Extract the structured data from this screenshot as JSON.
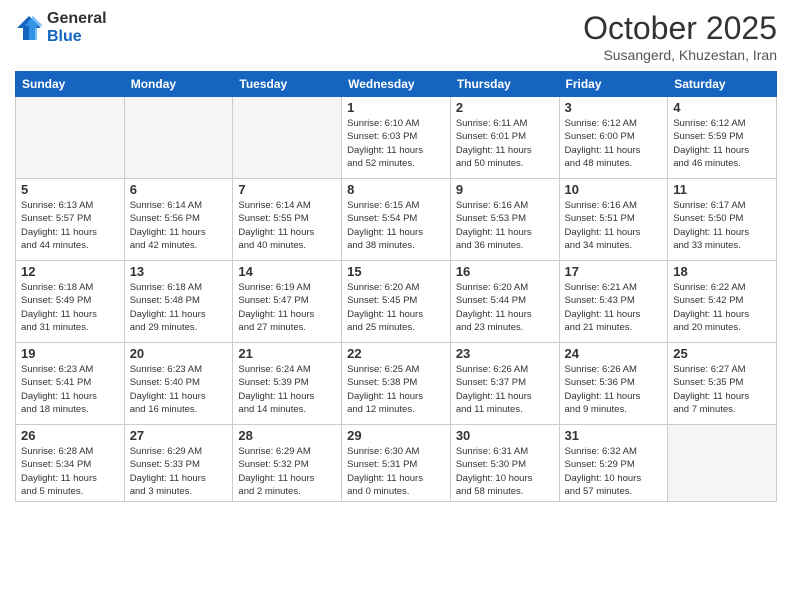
{
  "logo": {
    "general": "General",
    "blue": "Blue"
  },
  "header": {
    "month": "October 2025",
    "location": "Susangerd, Khuzestan, Iran"
  },
  "days_of_week": [
    "Sunday",
    "Monday",
    "Tuesday",
    "Wednesday",
    "Thursday",
    "Friday",
    "Saturday"
  ],
  "weeks": [
    [
      {
        "day": "",
        "info": ""
      },
      {
        "day": "",
        "info": ""
      },
      {
        "day": "",
        "info": ""
      },
      {
        "day": "1",
        "info": "Sunrise: 6:10 AM\nSunset: 6:03 PM\nDaylight: 11 hours\nand 52 minutes."
      },
      {
        "day": "2",
        "info": "Sunrise: 6:11 AM\nSunset: 6:01 PM\nDaylight: 11 hours\nand 50 minutes."
      },
      {
        "day": "3",
        "info": "Sunrise: 6:12 AM\nSunset: 6:00 PM\nDaylight: 11 hours\nand 48 minutes."
      },
      {
        "day": "4",
        "info": "Sunrise: 6:12 AM\nSunset: 5:59 PM\nDaylight: 11 hours\nand 46 minutes."
      }
    ],
    [
      {
        "day": "5",
        "info": "Sunrise: 6:13 AM\nSunset: 5:57 PM\nDaylight: 11 hours\nand 44 minutes."
      },
      {
        "day": "6",
        "info": "Sunrise: 6:14 AM\nSunset: 5:56 PM\nDaylight: 11 hours\nand 42 minutes."
      },
      {
        "day": "7",
        "info": "Sunrise: 6:14 AM\nSunset: 5:55 PM\nDaylight: 11 hours\nand 40 minutes."
      },
      {
        "day": "8",
        "info": "Sunrise: 6:15 AM\nSunset: 5:54 PM\nDaylight: 11 hours\nand 38 minutes."
      },
      {
        "day": "9",
        "info": "Sunrise: 6:16 AM\nSunset: 5:53 PM\nDaylight: 11 hours\nand 36 minutes."
      },
      {
        "day": "10",
        "info": "Sunrise: 6:16 AM\nSunset: 5:51 PM\nDaylight: 11 hours\nand 34 minutes."
      },
      {
        "day": "11",
        "info": "Sunrise: 6:17 AM\nSunset: 5:50 PM\nDaylight: 11 hours\nand 33 minutes."
      }
    ],
    [
      {
        "day": "12",
        "info": "Sunrise: 6:18 AM\nSunset: 5:49 PM\nDaylight: 11 hours\nand 31 minutes."
      },
      {
        "day": "13",
        "info": "Sunrise: 6:18 AM\nSunset: 5:48 PM\nDaylight: 11 hours\nand 29 minutes."
      },
      {
        "day": "14",
        "info": "Sunrise: 6:19 AM\nSunset: 5:47 PM\nDaylight: 11 hours\nand 27 minutes."
      },
      {
        "day": "15",
        "info": "Sunrise: 6:20 AM\nSunset: 5:45 PM\nDaylight: 11 hours\nand 25 minutes."
      },
      {
        "day": "16",
        "info": "Sunrise: 6:20 AM\nSunset: 5:44 PM\nDaylight: 11 hours\nand 23 minutes."
      },
      {
        "day": "17",
        "info": "Sunrise: 6:21 AM\nSunset: 5:43 PM\nDaylight: 11 hours\nand 21 minutes."
      },
      {
        "day": "18",
        "info": "Sunrise: 6:22 AM\nSunset: 5:42 PM\nDaylight: 11 hours\nand 20 minutes."
      }
    ],
    [
      {
        "day": "19",
        "info": "Sunrise: 6:23 AM\nSunset: 5:41 PM\nDaylight: 11 hours\nand 18 minutes."
      },
      {
        "day": "20",
        "info": "Sunrise: 6:23 AM\nSunset: 5:40 PM\nDaylight: 11 hours\nand 16 minutes."
      },
      {
        "day": "21",
        "info": "Sunrise: 6:24 AM\nSunset: 5:39 PM\nDaylight: 11 hours\nand 14 minutes."
      },
      {
        "day": "22",
        "info": "Sunrise: 6:25 AM\nSunset: 5:38 PM\nDaylight: 11 hours\nand 12 minutes."
      },
      {
        "day": "23",
        "info": "Sunrise: 6:26 AM\nSunset: 5:37 PM\nDaylight: 11 hours\nand 11 minutes."
      },
      {
        "day": "24",
        "info": "Sunrise: 6:26 AM\nSunset: 5:36 PM\nDaylight: 11 hours\nand 9 minutes."
      },
      {
        "day": "25",
        "info": "Sunrise: 6:27 AM\nSunset: 5:35 PM\nDaylight: 11 hours\nand 7 minutes."
      }
    ],
    [
      {
        "day": "26",
        "info": "Sunrise: 6:28 AM\nSunset: 5:34 PM\nDaylight: 11 hours\nand 5 minutes."
      },
      {
        "day": "27",
        "info": "Sunrise: 6:29 AM\nSunset: 5:33 PM\nDaylight: 11 hours\nand 3 minutes."
      },
      {
        "day": "28",
        "info": "Sunrise: 6:29 AM\nSunset: 5:32 PM\nDaylight: 11 hours\nand 2 minutes."
      },
      {
        "day": "29",
        "info": "Sunrise: 6:30 AM\nSunset: 5:31 PM\nDaylight: 11 hours\nand 0 minutes."
      },
      {
        "day": "30",
        "info": "Sunrise: 6:31 AM\nSunset: 5:30 PM\nDaylight: 10 hours\nand 58 minutes."
      },
      {
        "day": "31",
        "info": "Sunrise: 6:32 AM\nSunset: 5:29 PM\nDaylight: 10 hours\nand 57 minutes."
      },
      {
        "day": "",
        "info": ""
      }
    ]
  ]
}
